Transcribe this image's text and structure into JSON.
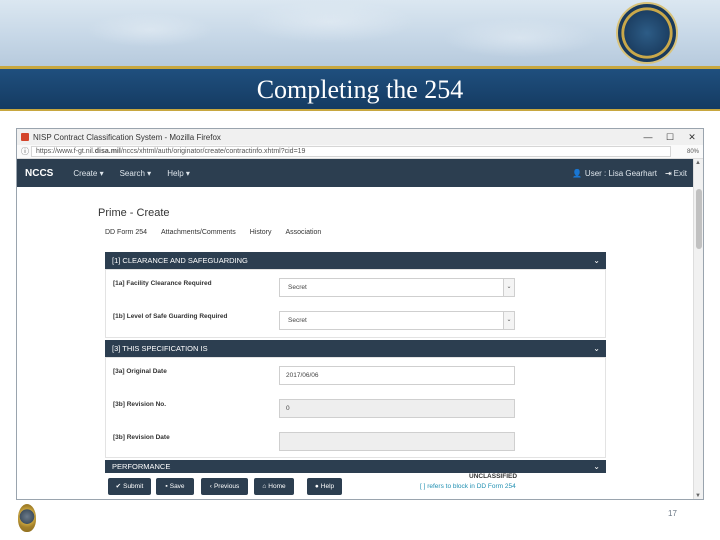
{
  "slide": {
    "title": "Completing the 254",
    "page_number": "17"
  },
  "browser": {
    "window_title": "NISP Contract Classification System - Mozilla Firefox",
    "url_prefix": "https://www.f-gt.nil.",
    "url_domain": "disa.mil",
    "url_path": "/nccs/xhtml/auth/originator/create/contractinfo.xhtml?cid=19",
    "zoom": "80%",
    "window_buttons": [
      "—",
      "☐",
      "✕"
    ]
  },
  "app_nav": {
    "brand": "NCCS",
    "menus": [
      "Create ▾",
      "Search ▾",
      "Help ▾"
    ],
    "user": "User : Lisa Gearhart",
    "exit": "Exit"
  },
  "page": {
    "title": "Prime - Create",
    "tabs": [
      "DD Form 254",
      "Attachments/Comments",
      "History",
      "Association"
    ]
  },
  "sections": {
    "clearance": {
      "header": "[1] CLEARANCE AND SAFEGUARDING",
      "facility_label": "[1a] Facility Clearance Required",
      "facility_value": "Secret",
      "safeguarding_label": "[1b] Level of Safe Guarding Required",
      "safeguarding_value": "Secret"
    },
    "specification": {
      "header": "[3] THIS SPECIFICATION IS",
      "original_date_label": "[3a] Original Date",
      "original_date_value": "2017/06/06",
      "revision_no_label": "[3b] Revision No.",
      "revision_no_value": "0",
      "revision_date_label": "[3b] Revision Date",
      "revision_date_value": ""
    },
    "performance": {
      "header": "PERFORMANCE"
    }
  },
  "buttons": {
    "submit": "Submit",
    "save": "Save",
    "previous": "Previous",
    "home": "Home",
    "help": "Help"
  },
  "footer_notes": {
    "classification": "UNCLASSIFIED",
    "reference": "[ ] refers to block in DD Form 254"
  }
}
